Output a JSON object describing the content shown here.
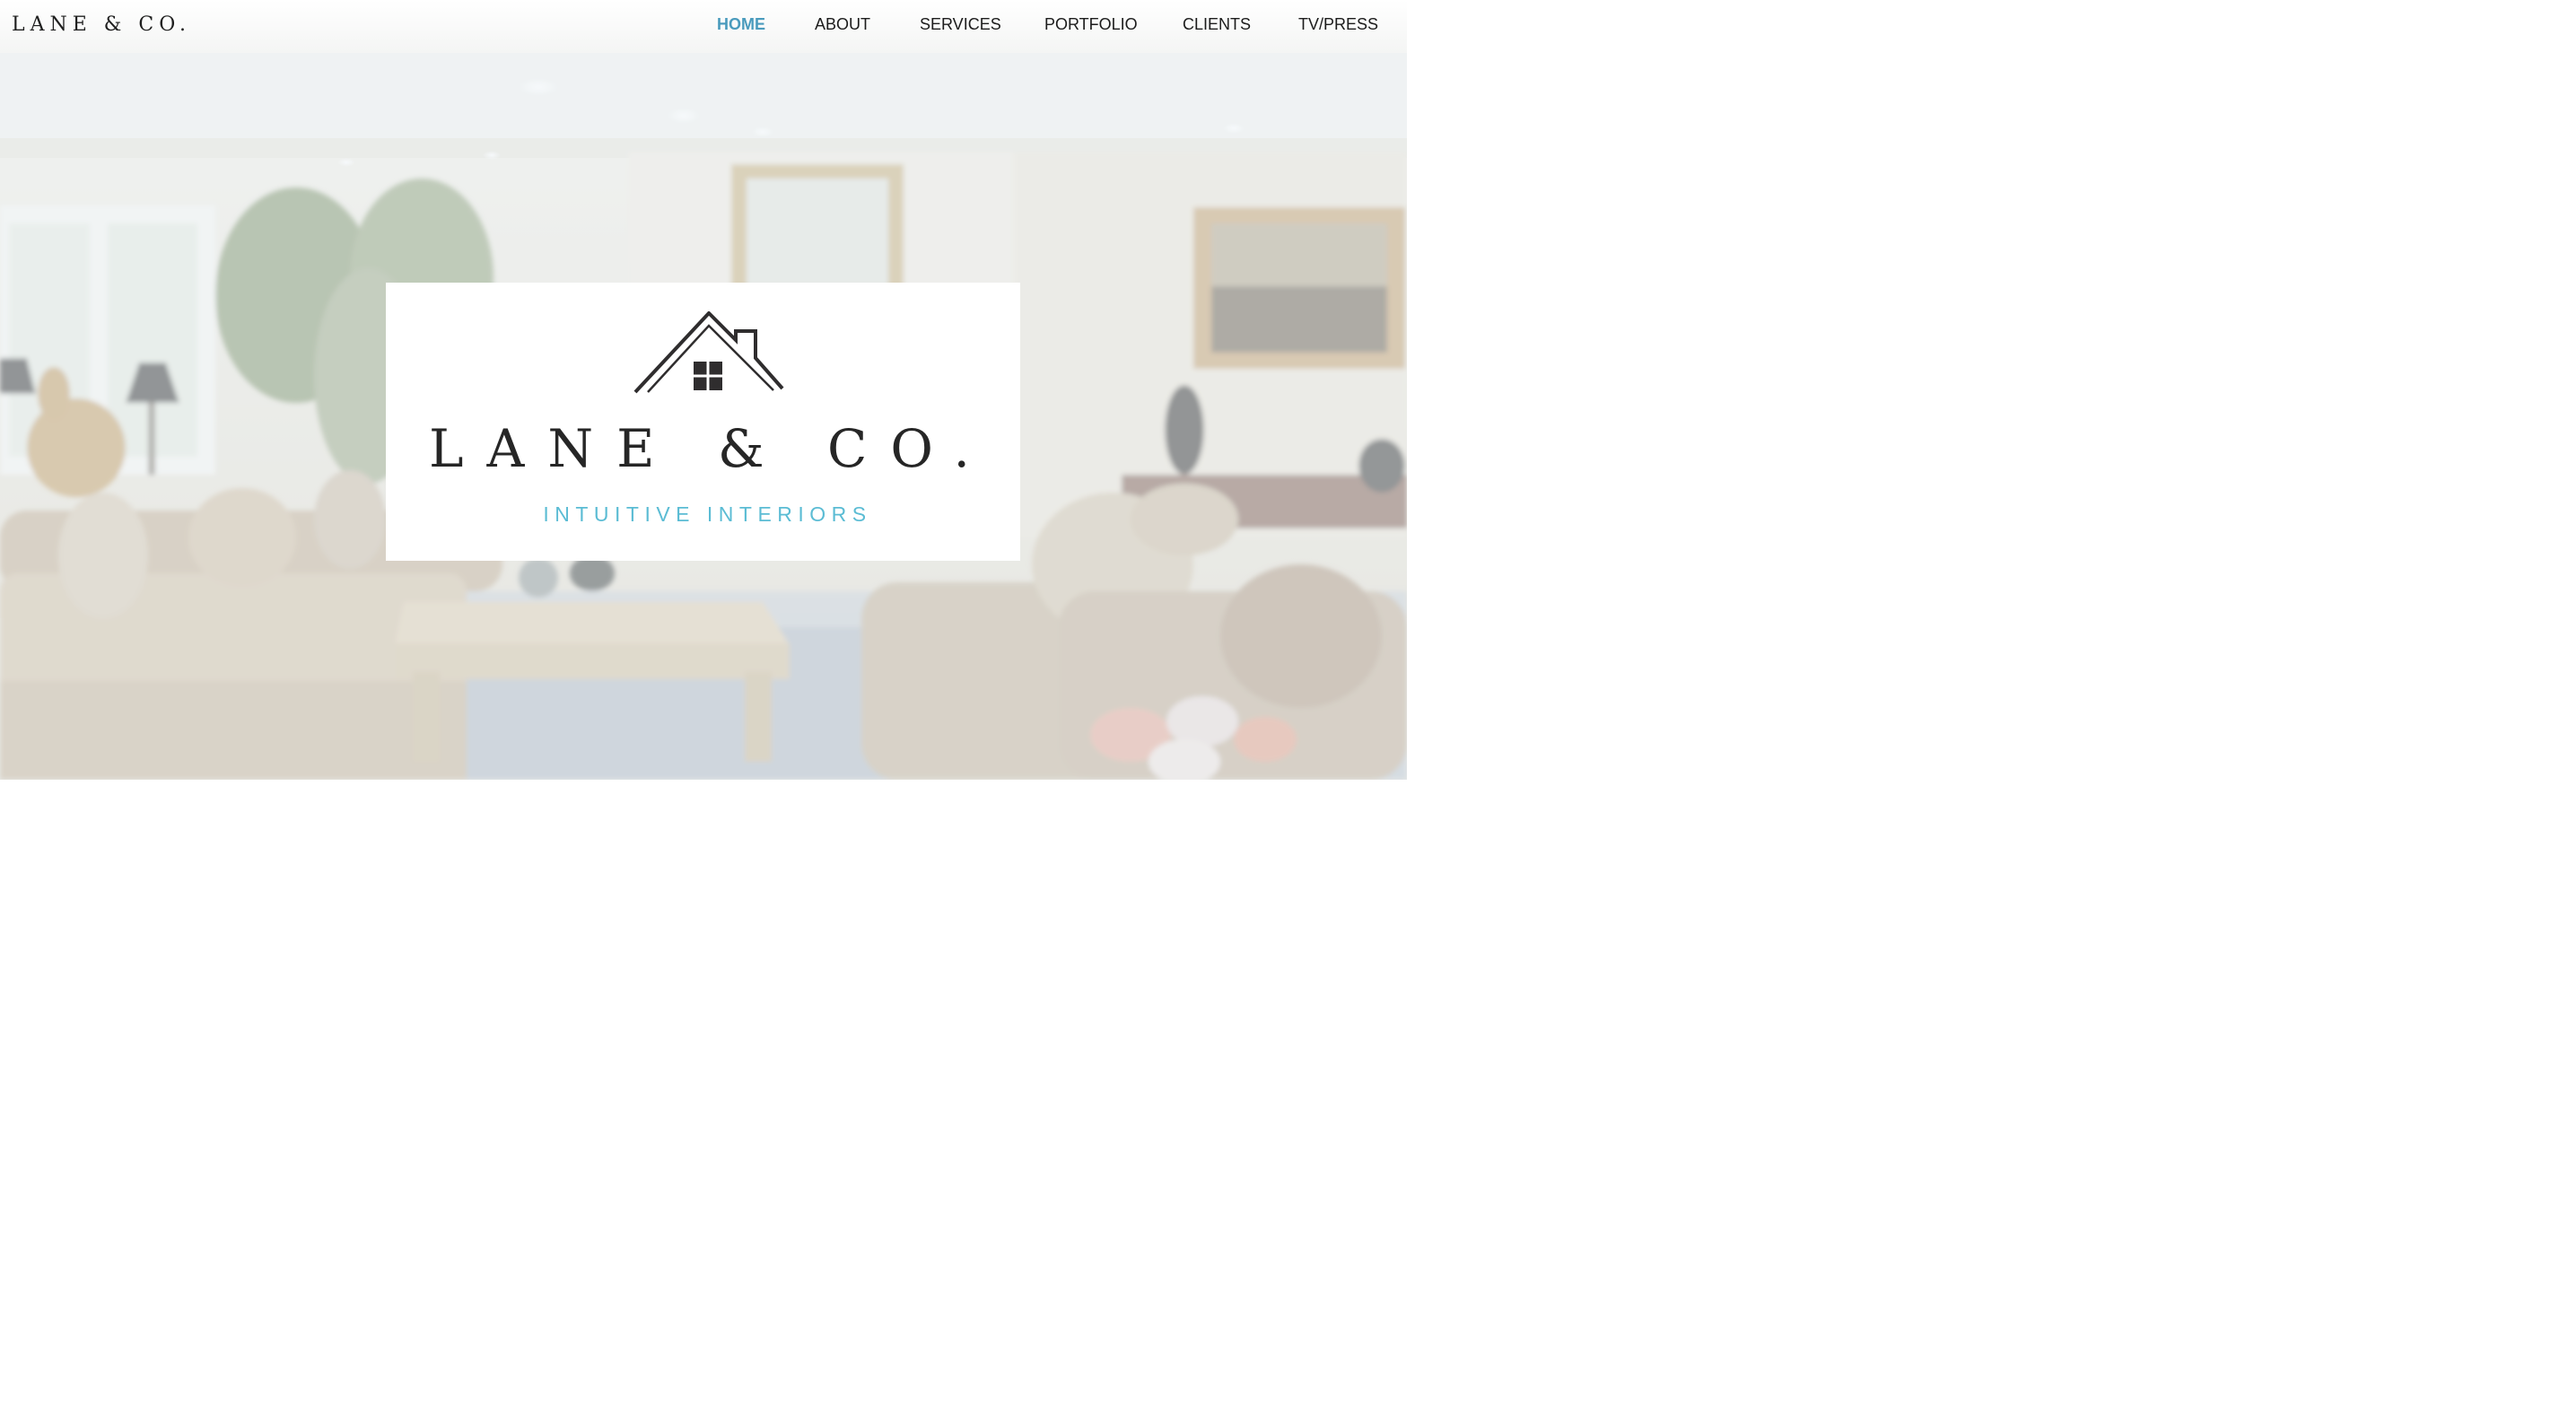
{
  "header": {
    "site_title": "LANE & CO.",
    "nav": [
      {
        "label": "HOME",
        "active": true
      },
      {
        "label": "ABOUT",
        "active": false
      },
      {
        "label": "SERVICES",
        "active": false
      },
      {
        "label": "PORTFOLIO",
        "active": false
      },
      {
        "label": "CLIENTS",
        "active": false
      },
      {
        "label": "TV/PRESS",
        "active": false
      }
    ]
  },
  "hero": {
    "background": "living-room-photo",
    "logo": {
      "icon": "house-roof-icon",
      "name": "LANE & CO.",
      "tagline": "INTUITIVE INTERIORS"
    }
  },
  "colors": {
    "accent": "#4a9bbd",
    "tagline": "#5bbcd4",
    "text": "#1c1c1c"
  }
}
